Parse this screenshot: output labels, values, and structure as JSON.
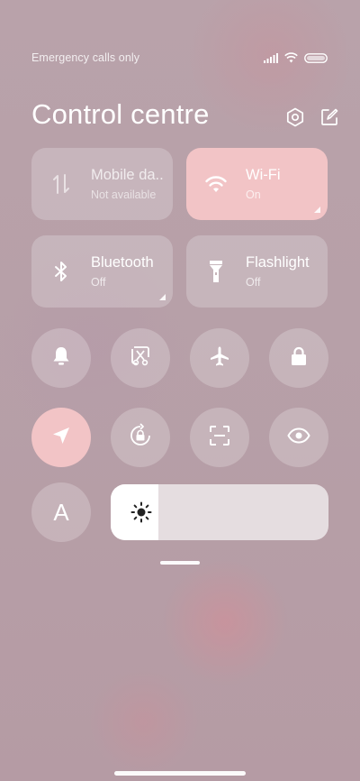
{
  "status_bar": {
    "carrier": "Emergency calls only"
  },
  "header": {
    "title": "Control centre"
  },
  "tiles": [
    {
      "label": "Mobile da..",
      "sub": "Not available",
      "icon": "mobile-data-icon",
      "state": "disabled"
    },
    {
      "label": "Wi-Fi",
      "sub": "On",
      "icon": "wifi-icon",
      "state": "on"
    },
    {
      "label": "Bluetooth",
      "sub": "Off",
      "icon": "bluetooth-icon",
      "state": "off"
    },
    {
      "label": "Flashlight",
      "sub": "Off",
      "icon": "flashlight-icon",
      "state": "off"
    }
  ],
  "toggles_row1": [
    "bell-icon",
    "screenshot-icon",
    "airplane-icon",
    "lock-icon"
  ],
  "toggles_row2": [
    "location-icon",
    "rotation-lock-icon",
    "scan-icon",
    "eye-icon"
  ],
  "auto_brightness": {
    "label": "A"
  },
  "brightness": {
    "level": 0.22
  },
  "colors": {
    "accent": "#f2c4c6",
    "tile_bg": "rgba(255,255,255,0.22)",
    "background": "#b9a2aa"
  }
}
